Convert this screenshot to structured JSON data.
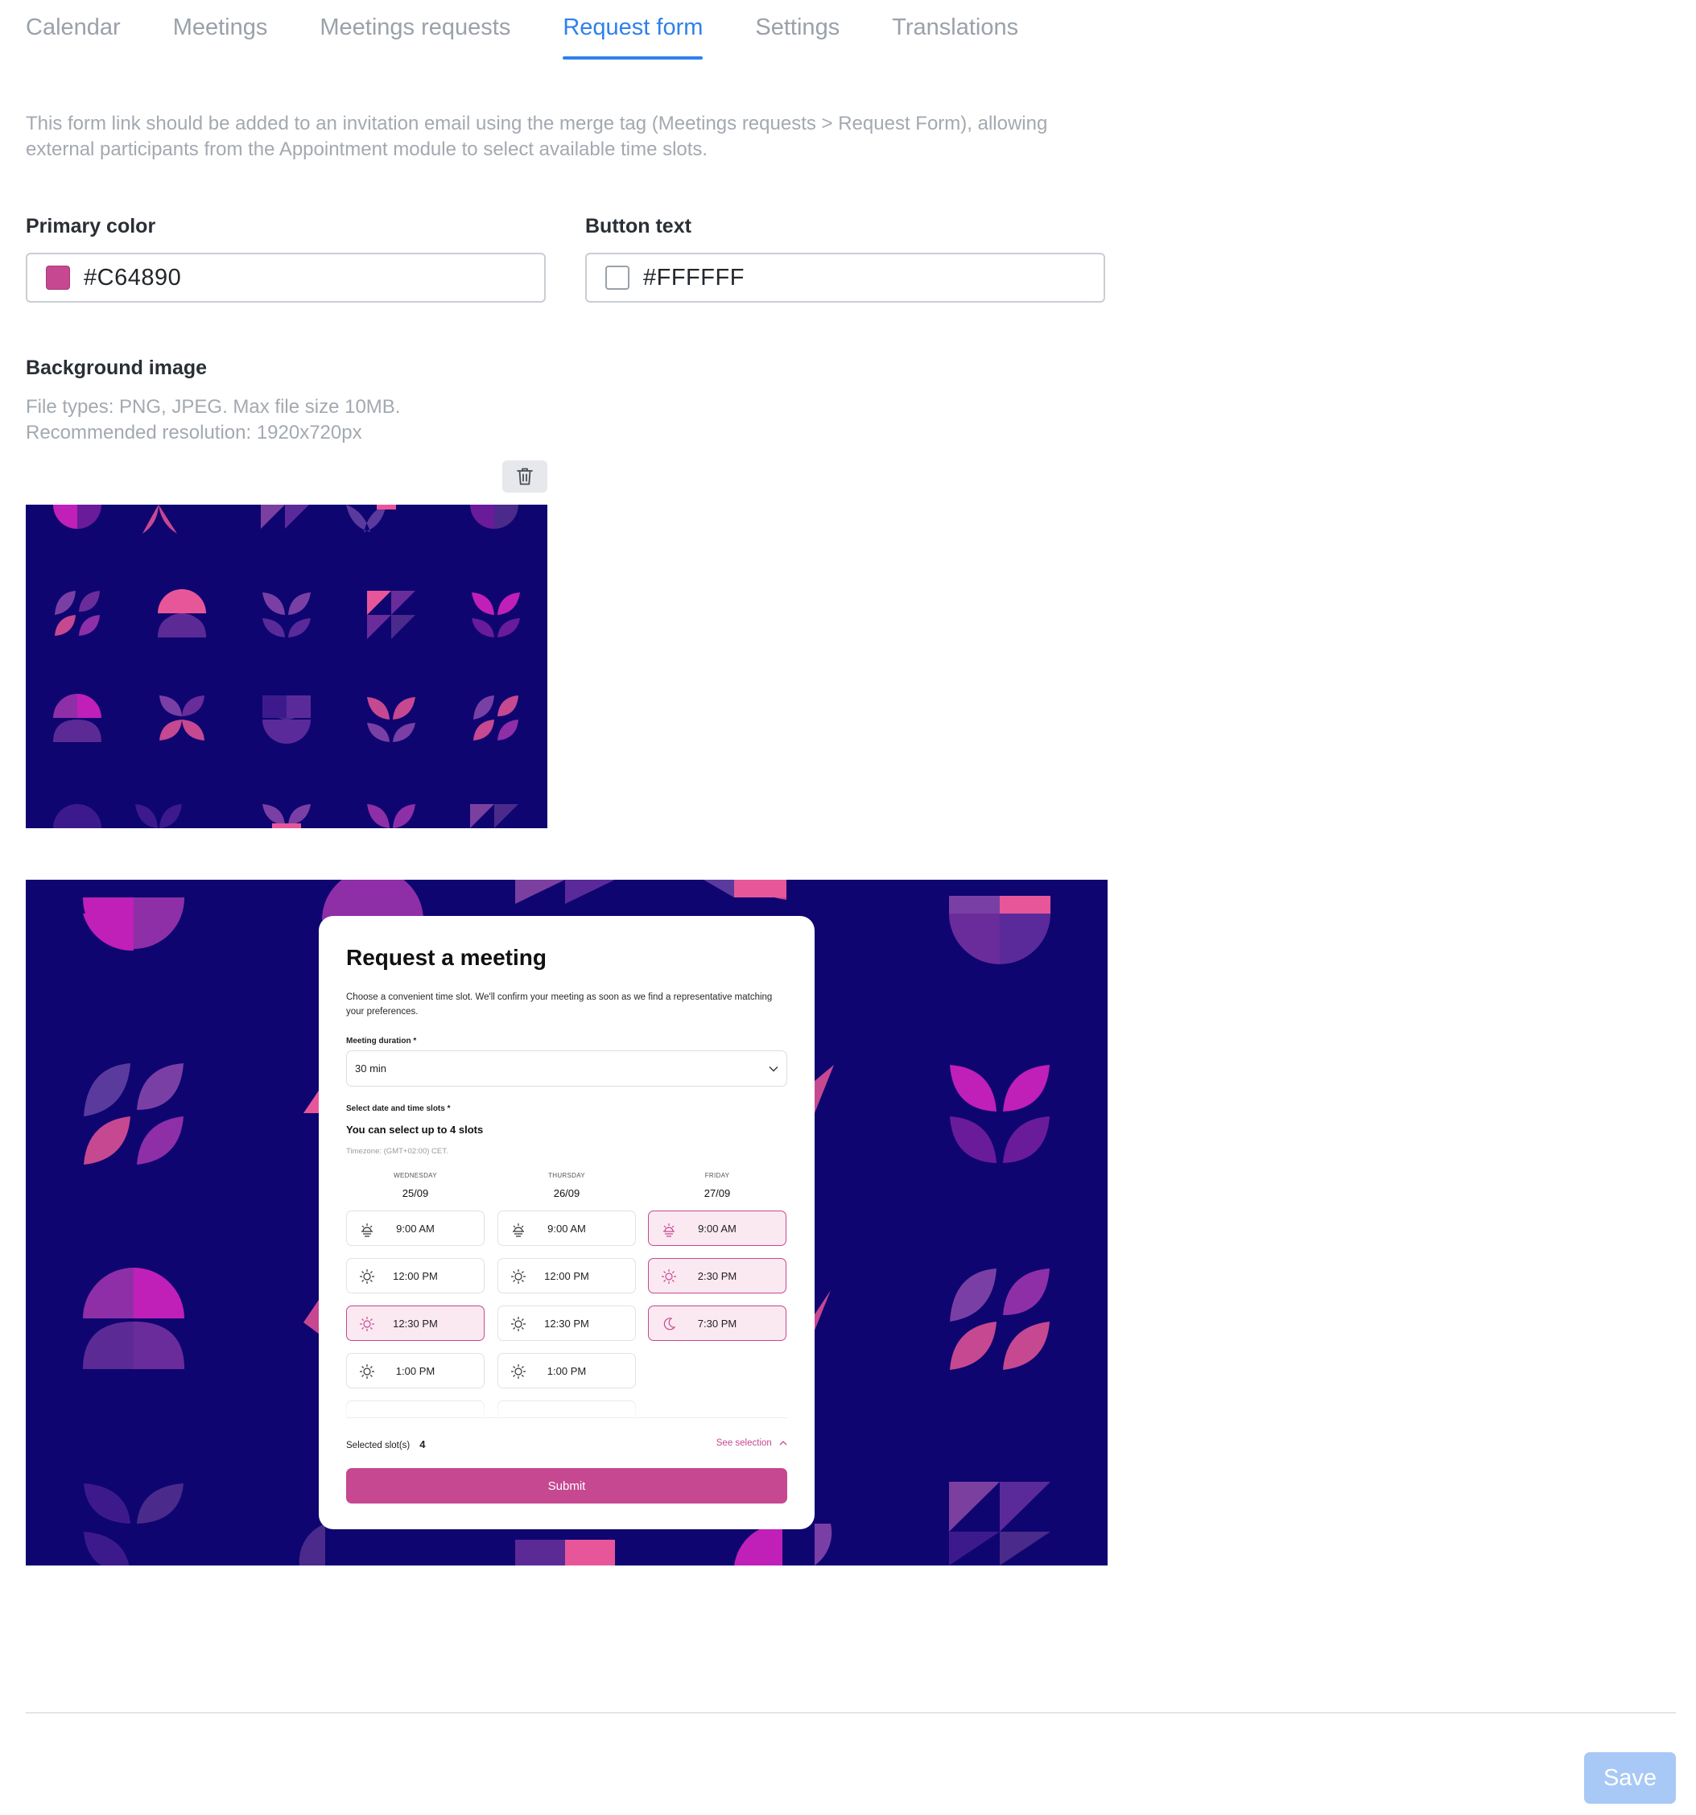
{
  "tabs": [
    {
      "label": "Calendar"
    },
    {
      "label": "Meetings"
    },
    {
      "label": "Meetings requests"
    },
    {
      "label": "Request form",
      "active": true
    },
    {
      "label": "Settings"
    },
    {
      "label": "Translations"
    }
  ],
  "description": "This form link should be added to an invitation email using the merge tag (Meetings requests > Request Form), allowing external participants from the Appointment module to select available time slots.",
  "primary_color": {
    "label": "Primary color",
    "value": "#C64890"
  },
  "button_text": {
    "label": "Button text",
    "value": "#FFFFFF"
  },
  "background_image": {
    "label": "Background image",
    "hint_line1": "File types: PNG, JPEG. Max file size 10MB.",
    "hint_line2": "Recommended resolution: 1920x720px",
    "delete_icon": "trash-icon"
  },
  "colors": {
    "background": "#0F0570",
    "primary": "#C64890",
    "pink": "#E8569A",
    "magenta": "#C01FB8",
    "purple": "#6A1B9A",
    "dark_purple": "#3D1A8C",
    "accent_blue": "#2F80ED"
  },
  "preview": {
    "title": "Request a meeting",
    "subtitle": "Choose a convenient time slot. We'll confirm your meeting as soon as we find a representative matching your preferences.",
    "duration_label": "Meeting duration *",
    "duration_value": "30 min",
    "slots_label": "Select date and time slots *",
    "can_select": "You can select up to 4 slots",
    "timezone": "Timezone: (GMT+02:00) CET.",
    "days": [
      {
        "name": "WEDNESDAY",
        "date": "25/09",
        "slots": [
          {
            "time": "9:00 AM",
            "icon": "sunrise-icon",
            "selected": false
          },
          {
            "time": "12:00 PM",
            "icon": "sun-icon",
            "selected": false
          },
          {
            "time": "12:30 PM",
            "icon": "sun-icon",
            "selected": true
          },
          {
            "time": "1:00 PM",
            "icon": "sun-icon",
            "selected": false
          }
        ]
      },
      {
        "name": "THURSDAY",
        "date": "26/09",
        "slots": [
          {
            "time": "9:00 AM",
            "icon": "sunrise-icon",
            "selected": false
          },
          {
            "time": "12:00 PM",
            "icon": "sun-icon",
            "selected": false
          },
          {
            "time": "12:30 PM",
            "icon": "sun-icon",
            "selected": false
          },
          {
            "time": "1:00 PM",
            "icon": "sun-icon",
            "selected": false
          }
        ]
      },
      {
        "name": "FRIDAY",
        "date": "27/09",
        "slots": [
          {
            "time": "9:00 AM",
            "icon": "sunrise-icon",
            "selected": true
          },
          {
            "time": "2:30 PM",
            "icon": "sun-icon",
            "selected": true
          },
          {
            "time": "7:30 PM",
            "icon": "moon-icon",
            "selected": true
          }
        ]
      }
    ],
    "selected_label": "Selected slot(s)",
    "selected_count": "4",
    "see_selection": "See selection",
    "submit": "Submit"
  },
  "save": "Save"
}
